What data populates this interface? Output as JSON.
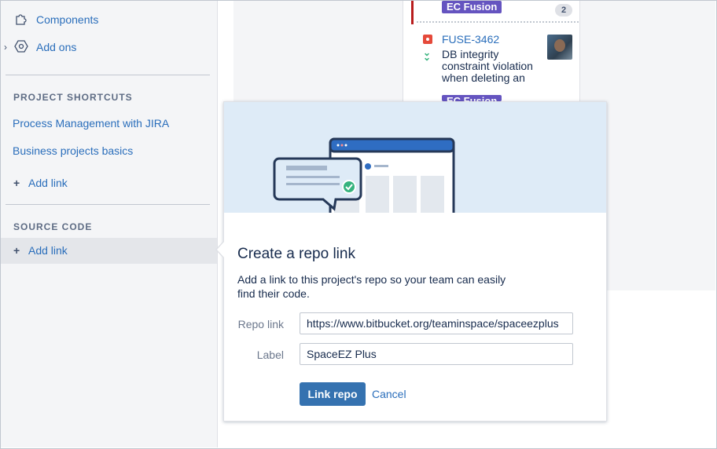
{
  "sidebar": {
    "items": [
      {
        "label": "Components",
        "icon": "puzzle-icon"
      },
      {
        "label": "Add ons",
        "icon": "hexagon-icon"
      }
    ],
    "project_shortcuts": {
      "heading": "PROJECT SHORTCUTS",
      "links": [
        "Process Management with JIRA",
        "Business projects basics"
      ],
      "add_link": "Add link"
    },
    "source_code": {
      "heading": "SOURCE CODE",
      "add_link": "Add link"
    }
  },
  "board": {
    "top_card": {
      "epic": "EC Fusion",
      "count": "2"
    },
    "card": {
      "key": "FUSE-3462",
      "summary": "DB integrity constraint violation when deleting an",
      "epic": "EC Fusion",
      "type_icon": "bug-icon",
      "priority_icon": "priority-low-icon"
    }
  },
  "dialog": {
    "title": "Create a repo link",
    "description": "Add a link to this project's repo so your team can easily find their code.",
    "repo_link_label": "Repo link",
    "repo_link_value": "https://www.bitbucket.org/teaminspace/spaceezplus",
    "label_label": "Label",
    "label_value": "SpaceEZ Plus",
    "submit_label": "Link repo",
    "cancel_label": "Cancel"
  },
  "colors": {
    "link": "#2a6ebb",
    "primary_button": "#3572b0",
    "epic_badge": "#6554c0",
    "hero_bg": "#deebf7"
  }
}
